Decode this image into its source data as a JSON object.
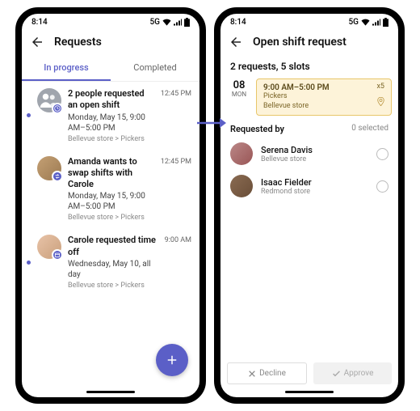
{
  "status": {
    "time": "8:14",
    "net": "5G"
  },
  "left": {
    "title": "Requests",
    "tabs": {
      "in_progress": "In progress",
      "completed": "Completed"
    },
    "items": [
      {
        "title": "2 people requested an open shift",
        "sub": "Monday, May 15, 9:00 AM–5:00 PM",
        "meta": "Bellevue store > Pickers",
        "time": "12:45 PM",
        "unread": true
      },
      {
        "title": "Amanda wants to swap shifts with Carole",
        "sub": "Monday, May 15, 9:00 AM–5:00 PM",
        "meta": "Bellevue store > Pickers",
        "time": "12:45 PM",
        "unread": false
      },
      {
        "title": "Carole requested time off",
        "sub": "Wednesday, May 10, all day",
        "meta": "Bellevue store > Pickers",
        "time": "9:00 AM",
        "unread": true
      }
    ]
  },
  "right": {
    "title": "Open shift request",
    "summary": "2 requests, 5 slots",
    "shift": {
      "day": "08",
      "wk": "MON",
      "time": "9:00 AM–5:00 PM",
      "role": "Pickers",
      "store": "Bellevue store",
      "count": "x5"
    },
    "requested_by_label": "Requested by",
    "selected": "0 selected",
    "requesters": [
      {
        "name": "Serena Davis",
        "store": "Bellevue store"
      },
      {
        "name": "Isaac Fielder",
        "store": "Redmond store"
      }
    ],
    "decline": "Decline",
    "approve": "Approve"
  }
}
